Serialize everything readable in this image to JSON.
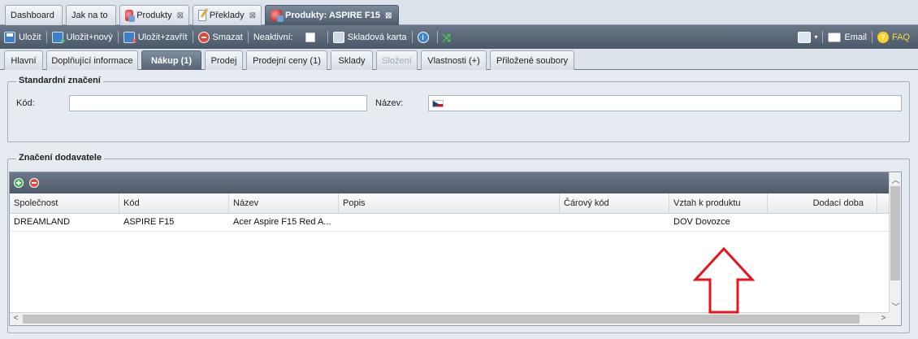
{
  "top_tabs": [
    {
      "label": "Dashboard"
    },
    {
      "label": "Jak na to"
    },
    {
      "label": "Produkty"
    },
    {
      "label": "Překlady"
    },
    {
      "label": "Produkty: ASPIRE F15"
    }
  ],
  "toolbar": {
    "save": "Uložit",
    "save_new": "Uložit+nový",
    "save_close": "Uložit+zavřít",
    "delete": "Smazat",
    "inactive": "Neaktivní:",
    "stock_card": "Skladová karta",
    "email": "Email",
    "faq": "FAQ"
  },
  "sub_tabs": [
    {
      "label": "Hlavní"
    },
    {
      "label": "Doplňující informace"
    },
    {
      "label": "Nákup (1)"
    },
    {
      "label": "Prodej"
    },
    {
      "label": "Prodejní ceny (1)"
    },
    {
      "label": "Sklady"
    },
    {
      "label": "Složení"
    },
    {
      "label": "Vlastnosti (+)"
    },
    {
      "label": "Přiložené soubory"
    }
  ],
  "standard": {
    "legend": "Standardní značení",
    "code_label": "Kód:",
    "code_value": "",
    "name_label": "Název:",
    "name_value": ""
  },
  "supplier": {
    "legend": "Značení dodavatele",
    "columns": [
      "Společnost",
      "Kód",
      "Název",
      "Popis",
      "Čárový kód",
      "Vztah k produktu",
      "Dodací doba"
    ],
    "rows": [
      {
        "company": "DREAMLAND",
        "code": "ASPIRE F15",
        "name": "Acer Aspire F15 Red A...",
        "description": "",
        "barcode": "",
        "relation": "DOV Dovozce",
        "delivery": ""
      }
    ]
  },
  "colors": {
    "toolbar_bg": "#56636f",
    "active_tab": "#5b6a7b",
    "annotation_arrow": "#e8141b",
    "faq": "#ffd840"
  }
}
